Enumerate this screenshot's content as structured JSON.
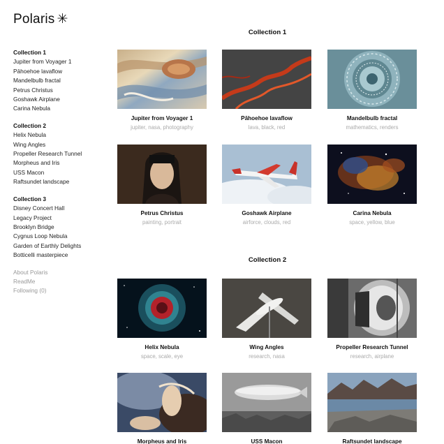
{
  "site": {
    "title": "Polaris",
    "logo_icon": "asterisk-icon"
  },
  "sidebar": {
    "collections": [
      {
        "title": "Collection 1",
        "items": [
          "Jupiter from Voyager 1",
          "Pāhoehoe lavaflow",
          "Mandelbulb fractal",
          "Petrus Christus",
          "Goshawk Airplane",
          "Carina Nebula"
        ]
      },
      {
        "title": "Collection 2",
        "items": [
          "Helix Nebula",
          "Wing Angles",
          "Propeller Research Tunnel",
          "Morpheus and Iris",
          "USS Macon",
          "Raftsundet landscape"
        ]
      },
      {
        "title": "Collection 3",
        "items": [
          "Disney Concert Hall",
          "Legacy Project",
          "Brooklyn Bridge",
          "Cygnus Loop Nebula",
          "Garden of Earthly Delights",
          "Botticelli masterpiece"
        ]
      }
    ],
    "footer": [
      "About Polaris",
      "ReadMe",
      "Following  (0)"
    ]
  },
  "main": {
    "sections": [
      {
        "title": "Collection 1",
        "cards": [
          {
            "title": "Jupiter from Voyager 1",
            "tags": "jupiter, nasa, photography"
          },
          {
            "title": "Pāhoehoe lavaflow",
            "tags": "lava, black, red"
          },
          {
            "title": "Mandelbulb fractal",
            "tags": "mathematics, renders"
          },
          {
            "title": "Petrus Christus",
            "tags": "painting, portrait"
          },
          {
            "title": "Goshawk Airplane",
            "tags": "airforce, clouds, red"
          },
          {
            "title": "Carina Nebula",
            "tags": "space, yellow, blue"
          }
        ]
      },
      {
        "title": "Collection 2",
        "cards": [
          {
            "title": "Helix Nebula",
            "tags": "space, scale, eye"
          },
          {
            "title": "Wing Angles",
            "tags": "research, nasa"
          },
          {
            "title": "Propeller Research Tunnel",
            "tags": "research, airplane"
          },
          {
            "title": "Morpheus and Iris",
            "tags": ""
          },
          {
            "title": "USS Macon",
            "tags": ""
          },
          {
            "title": "Raftsundet landscape",
            "tags": ""
          }
        ]
      }
    ]
  }
}
